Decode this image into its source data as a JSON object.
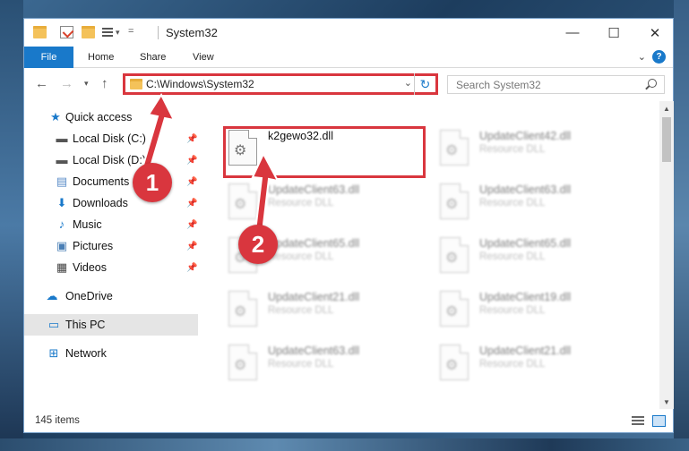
{
  "window": {
    "title": "System32",
    "controls": {
      "minimize": "—",
      "maximize": "☐",
      "close": "✕"
    }
  },
  "ribbon": {
    "tabs": [
      "File",
      "Home",
      "Share",
      "View"
    ],
    "help": "?"
  },
  "navigation": {
    "back_icon": "back-arrow-icon",
    "forward_icon": "forward-arrow-icon",
    "recent_icon": "chevron-down-icon",
    "up_icon": "up-arrow-icon",
    "address": "C:\\Windows\\System32",
    "search_placeholder": "Search System32"
  },
  "sidebar": {
    "items": [
      {
        "label": "Quick access",
        "icon": "star-icon",
        "pinned": false
      },
      {
        "label": "Local Disk (C:)",
        "icon": "drive-icon",
        "pinned": true
      },
      {
        "label": "Local Disk (D:)",
        "icon": "drive-icon",
        "pinned": true
      },
      {
        "label": "Documents",
        "icon": "documents-icon",
        "pinned": true
      },
      {
        "label": "Downloads",
        "icon": "downloads-icon",
        "pinned": true
      },
      {
        "label": "Music",
        "icon": "music-icon",
        "pinned": true
      },
      {
        "label": "Pictures",
        "icon": "pictures-icon",
        "pinned": true
      },
      {
        "label": "Videos",
        "icon": "videos-icon",
        "pinned": true
      },
      {
        "label": "OneDrive",
        "icon": "cloud-icon",
        "pinned": false
      },
      {
        "label": "This PC",
        "icon": "computer-icon",
        "pinned": false,
        "selected": true
      },
      {
        "label": "Network",
        "icon": "network-icon",
        "pinned": false
      }
    ]
  },
  "files": [
    {
      "name": "k2gewo32.dll",
      "type": "",
      "highlighted": true
    },
    {
      "name": "UpdateClient42.dll",
      "type": "Resource DLL"
    },
    {
      "name": "UpdateClient63.dll",
      "type": "Resource DLL"
    },
    {
      "name": "UpdateClient63.dll",
      "type": "Resource DLL"
    },
    {
      "name": "UpdateClient65.dll",
      "type": "Resource DLL"
    },
    {
      "name": "UpdateClient65.dll",
      "type": "Resource DLL"
    },
    {
      "name": "UpdateClient21.dll",
      "type": "Resource DLL"
    },
    {
      "name": "UpdateClient19.dll",
      "type": "Resource DLL"
    },
    {
      "name": "UpdateClient63.dll",
      "type": "Resource DLL"
    },
    {
      "name": "UpdateClient21.dll",
      "type": "Resource DLL"
    }
  ],
  "status": {
    "item_count": "145 items"
  },
  "callouts": {
    "step1": "1",
    "step2": "2"
  },
  "colors": {
    "accent": "#1979ca",
    "callout": "#d9363e"
  }
}
